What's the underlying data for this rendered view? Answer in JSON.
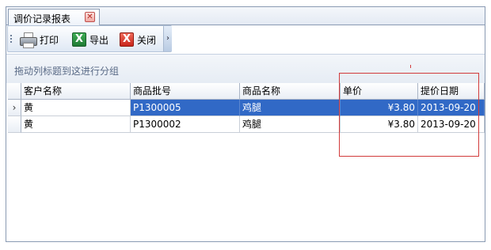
{
  "tab": {
    "title": "调价记录报表",
    "close_glyph": "✕"
  },
  "toolbar": {
    "print_label": "打印",
    "export_label": "导出",
    "close_label": "关闭",
    "more_glyph": "›",
    "export_icon_glyph": "X",
    "close_icon_glyph": "X"
  },
  "group_panel": {
    "hint": "拖动列标题到这进行分组"
  },
  "grid": {
    "columns": [
      "客户名称",
      "商品批号",
      "商品名称",
      "单价",
      "提价日期"
    ],
    "rows": [
      {
        "indicator": "›",
        "customer": "黄",
        "batch": "P1300005",
        "product": "鸡腿",
        "price": "¥3.80",
        "date": "2013-09-20",
        "selected": true
      },
      {
        "indicator": "",
        "customer": "黄",
        "batch": "P1300002",
        "product": "鸡腿",
        "price": "¥3.80",
        "date": "2013-09-20",
        "selected": false
      }
    ]
  },
  "colors": {
    "selection": "#3169c6",
    "highlight_box": "#d23b3b",
    "frame_border": "#8a9bb3"
  }
}
